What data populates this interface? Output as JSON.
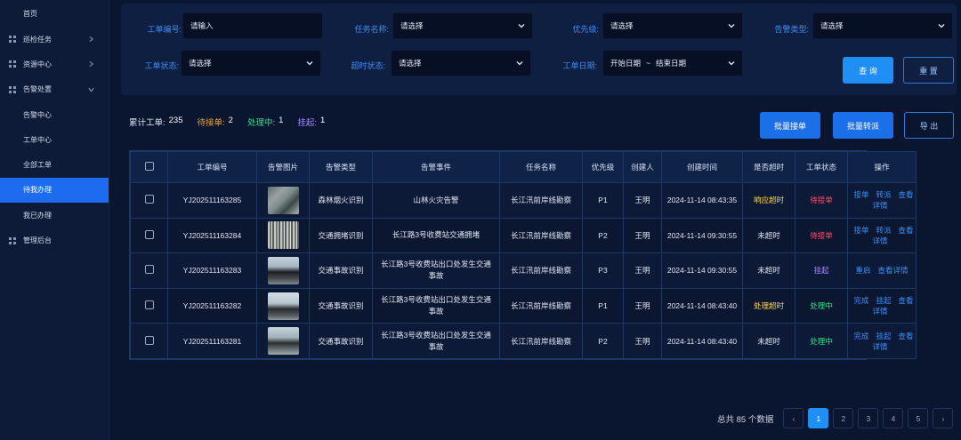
{
  "sidebar": {
    "items": [
      {
        "label": "首页",
        "icon": "",
        "chevron": false
      },
      {
        "label": "巡检任务",
        "icon": "grid-icon",
        "chevron": true
      },
      {
        "label": "资源中心",
        "icon": "grid-icon",
        "chevron": true
      },
      {
        "label": "告警处置",
        "icon": "grid-icon",
        "chevron": true,
        "expanded": true
      },
      {
        "label": "告警中心",
        "sub": true
      },
      {
        "label": "工单中心",
        "sub": true
      },
      {
        "label": "全部工单",
        "sub": true
      },
      {
        "label": "待我办理",
        "sub": true,
        "active": true
      },
      {
        "label": "我已办理",
        "sub": true
      },
      {
        "label": "管理后台",
        "icon": "grid-icon",
        "chevron": false
      }
    ]
  },
  "filters": {
    "order_no_label": "工单编号:",
    "order_no_placeholder": "请输入",
    "task_name_label": "任务名称:",
    "task_name_value": "请选择",
    "priority_label": "优先级:",
    "priority_value": "请选择",
    "alarm_type_label": "告警类型:",
    "alarm_type_value": "请选择",
    "order_status_label": "工单状态:",
    "order_status_value": "请选择",
    "timeout_label": "超时状态:",
    "timeout_value": "请选择",
    "date_label": "工单日期:",
    "date_start": "开始日期",
    "date_sep": "~",
    "date_end": "结束日期",
    "query_button": "查 询",
    "reset_button": "重 置"
  },
  "stats": {
    "total_label": "累计工单:",
    "total_value": "235",
    "pending_label": "待接单:",
    "pending_value": "2",
    "processing_label": "处理中:",
    "processing_value": "1",
    "suspended_label": "挂起:",
    "suspended_value": "1"
  },
  "actions": {
    "batch_accept": "批量接单",
    "batch_transfer": "批量转派",
    "export": "导 出"
  },
  "table": {
    "headers": [
      "",
      "工单编号",
      "告警图片",
      "告警类型",
      "告警事件",
      "任务名称",
      "优先级",
      "创建人",
      "创建时间",
      "是否超时",
      "工单状态",
      "操作"
    ],
    "rows": [
      {
        "id": "YJ202511163285",
        "thumb": "fire",
        "type": "森林烟火识别",
        "event": "山林火灾告警",
        "task": "长江汛前岸线勘察",
        "priority": "P1",
        "creator": "王明",
        "time": "2024-11-14 08:43:35",
        "timeout": "响应超时",
        "timeout_class": "time-yellow",
        "status": "待接单",
        "status_class": "st-red",
        "ops": [
          "接单",
          "转派",
          "查看详情"
        ]
      },
      {
        "id": "YJ202511163284",
        "thumb": "jam",
        "type": "交通拥堵识别",
        "event": "长江路3号收费站交通拥堵",
        "task": "长江汛前岸线勘察",
        "priority": "P2",
        "creator": "王明",
        "time": "2024-11-14 09:30:55",
        "timeout": "未超时",
        "timeout_class": "",
        "status": "待接单",
        "status_class": "st-red",
        "ops": [
          "接单",
          "转派",
          "查看详情"
        ]
      },
      {
        "id": "YJ202511163283",
        "thumb": "acc1",
        "type": "交通事故识别",
        "event": "长江路3号收费站出口处发生交通事故",
        "task": "长江汛前岸线勘察",
        "priority": "P3",
        "creator": "王明",
        "time": "2024-11-14 09:30:55",
        "timeout": "未超时",
        "timeout_class": "",
        "status": "挂起",
        "status_class": "st-purple",
        "ops": [
          "重启",
          "查看详情"
        ]
      },
      {
        "id": "YJ202511163282",
        "thumb": "acc2",
        "type": "交通事故识别",
        "event": "长江路3号收费站出口处发生交通事故",
        "task": "长江汛前岸线勘察",
        "priority": "P1",
        "creator": "王明",
        "time": "2024-11-14 08:43:40",
        "timeout": "处理超时",
        "timeout_class": "time-red",
        "status": "处理中",
        "status_class": "st-green",
        "ops": [
          "完成",
          "挂起",
          "查看详情"
        ]
      },
      {
        "id": "YJ202511163281",
        "thumb": "acc3",
        "type": "交通事故识别",
        "event": "长江路3号收费站出口处发生交通事故",
        "task": "长江汛前岸线勘察",
        "priority": "P2",
        "creator": "王明",
        "time": "2024-11-14 08:43:40",
        "timeout": "未超时",
        "timeout_class": "",
        "status": "处理中",
        "status_class": "st-green",
        "ops": [
          "完成",
          "挂起",
          "查看详情"
        ]
      }
    ]
  },
  "pagination": {
    "total_text": "总共 85 个数据",
    "prev": "‹",
    "pages": [
      "1",
      "2",
      "3",
      "4",
      "5"
    ],
    "current": "1",
    "next": "›"
  }
}
